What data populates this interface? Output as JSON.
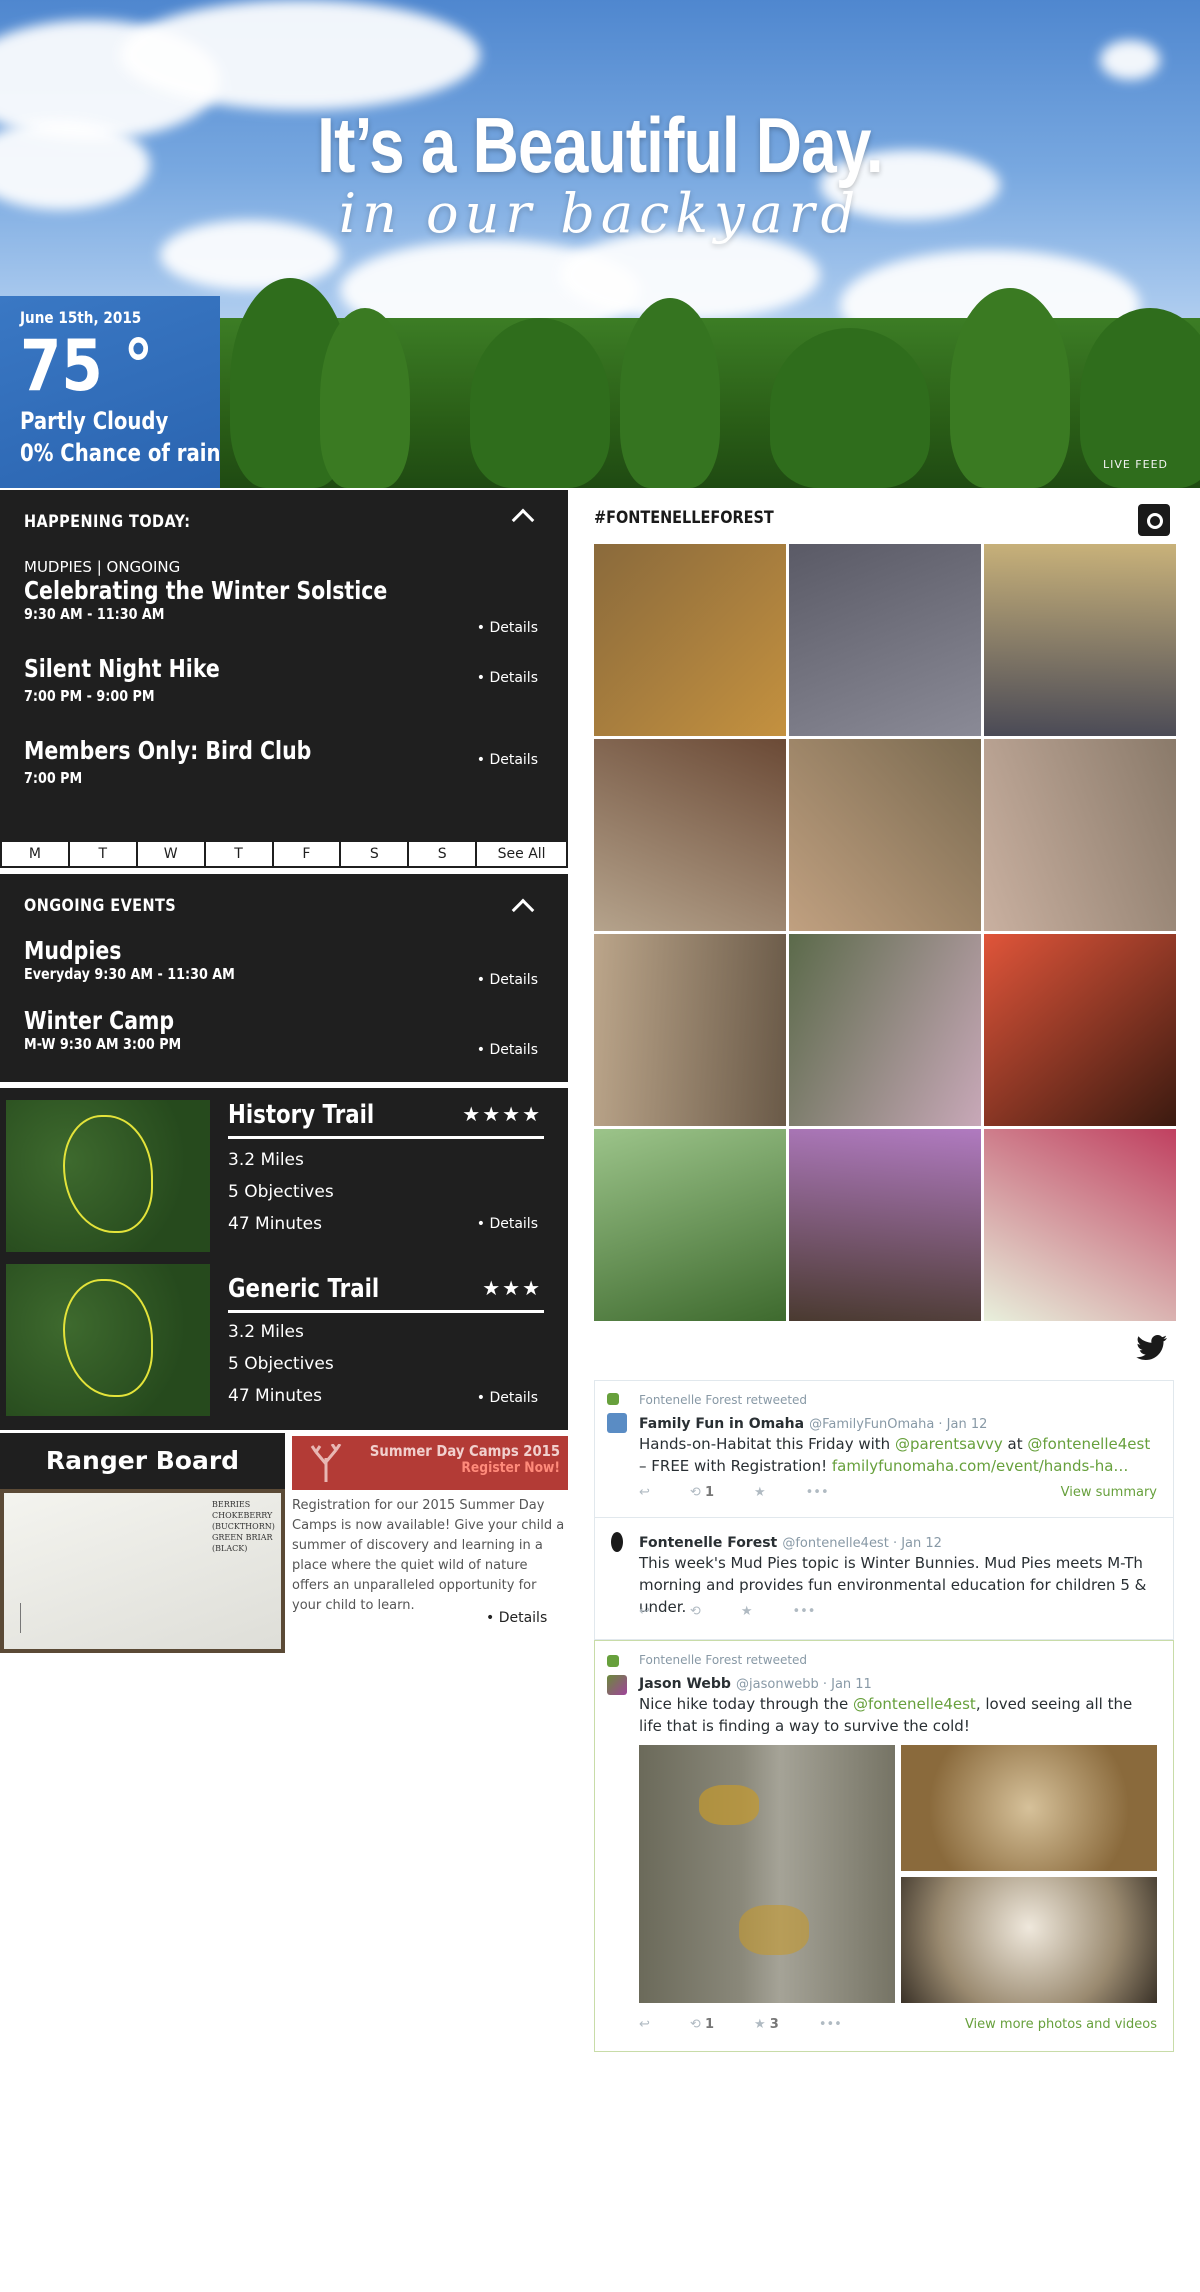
{
  "hero": {
    "title": "It’s a Beautiful Day.",
    "subtitle": "in our backyard",
    "live_feed_label": "LIVE FEED"
  },
  "weather": {
    "date": "June 15th, 2015",
    "temperature": "75 °",
    "condition": "Partly Cloudy",
    "rain": "0% Chance of rain"
  },
  "happening_today": {
    "heading": "HAPPENING TODAY:",
    "events": [
      {
        "tag": "MUDPIES | ONGOING",
        "title": "Celebrating the Winter Solstice",
        "time": "9:30 AM - 11:30 AM",
        "details": "• Details"
      },
      {
        "title": "Silent Night Hike",
        "time": "7:00 PM - 9:00 PM",
        "details": "• Details"
      },
      {
        "title": "Members Only: Bird Club",
        "time": "7:00 PM",
        "details": "• Details"
      }
    ],
    "days": [
      "M",
      "T",
      "W",
      "T",
      "F",
      "S",
      "S",
      "See All"
    ]
  },
  "ongoing": {
    "heading": "ONGOING EVENTS",
    "events": [
      {
        "title": "Mudpies",
        "time": "Everyday 9:30 AM - 11:30 AM",
        "details": "• Details"
      },
      {
        "title": "Winter Camp",
        "time": "M-W 9:30 AM 3:00 PM",
        "details": "• Details"
      }
    ]
  },
  "trails": [
    {
      "name": "History Trail",
      "stars": "★★★★",
      "rating": 4,
      "miles": "3.2 Miles",
      "objectives": "5 Objectives",
      "minutes": "47 Minutes",
      "details": "• Details"
    },
    {
      "name": "Generic Trail",
      "stars": "★★★",
      "rating": 3,
      "miles": "3.2 Miles",
      "objectives": "5 Objectives",
      "minutes": "47 Minutes",
      "details": "• Details"
    }
  ],
  "ranger_board": {
    "title": "Ranger Board",
    "board_lines": [
      "BERRIES",
      "CHOKEBERRY",
      "(BUCKTHORN)",
      "GREEN BRIAR",
      "(BLACK)"
    ]
  },
  "summer_camps": {
    "banner_title": "Summer Day Camps 2015",
    "banner_cta": "Register Now!",
    "text": "Registration for our 2015 Summer Day Camps is now available! Give your child a summer of discovery and learning in a place where the quiet wild of nature offers an unparalleled opportunity for your child to learn.",
    "details": "• Details"
  },
  "instagram": {
    "hashtag": "#FONTENELLEFOREST",
    "icon": "instagram-icon",
    "photo_colors": [
      [
        "#8a6a3c",
        "#c4913f"
      ],
      [
        "#5a5a66",
        "#8a8a96"
      ],
      [
        "#c9b27a",
        "#4a4a56"
      ],
      [
        "#6b4a36",
        "#b5a38c"
      ],
      [
        "#7a6a50",
        "#c0a080"
      ],
      [
        "#8a7a6a",
        "#c9b0a0"
      ],
      [
        "#6a5a48",
        "#bba58a"
      ],
      [
        "#c8a8b8",
        "#5b6a4a"
      ],
      [
        "#3b1a10",
        "#e0553a"
      ],
      [
        "#3e6a2e",
        "#9cc48a"
      ],
      [
        "#4a3a30",
        "#b07ac0"
      ],
      [
        "#e8f0dc",
        "#c04060"
      ]
    ]
  },
  "twitter": {
    "icon": "twitter-icon",
    "tweets": [
      {
        "retweet_label": "Fontenelle Forest retweeted",
        "name": "Family Fun in Omaha",
        "handle": "@FamilyFunOmaha · Jan 12",
        "body_parts": [
          "Hands-on-Habitat this Friday with ",
          "@parentsavvy",
          " at ",
          "@fontenelle4est",
          " – FREE with Registration! ",
          "familyfunomaha.com/event/hands-ha…"
        ],
        "retweets": "1",
        "favorites": "",
        "summary": "View summary"
      },
      {
        "name": "Fontenelle Forest",
        "handle": "@fontenelle4est · Jan 12",
        "body": "This week's Mud Pies topic is Winter Bunnies. Mud Pies meets M-Th morning and provides fun environmental education for children 5 & under."
      },
      {
        "retweet_label": "Fontenelle Forest retweeted",
        "name": "Jason Webb",
        "handle": "@jasonwebb · Jan 11",
        "body_parts": [
          "Nice hike today through the ",
          "@fontenelle4est",
          ", loved seeing all the life that is finding a way to survive the cold!"
        ],
        "retweets": "1",
        "favorites": "3",
        "summary": "View more photos and videos"
      }
    ]
  }
}
